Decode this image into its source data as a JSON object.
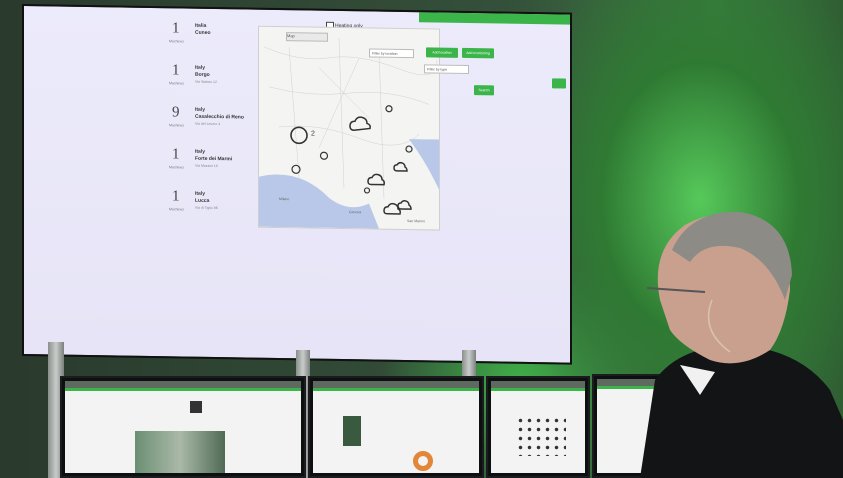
{
  "screen": {
    "top_labels": [
      "Heating only",
      "Filter by location",
      "Filter by type"
    ],
    "buttons": [
      "Add location",
      "Add monitoring",
      "Search"
    ],
    "map_search": "Map"
  },
  "locations": [
    {
      "count": "1",
      "count_label": "Machines",
      "country": "Italia",
      "city": "Cuneo",
      "address": ""
    },
    {
      "count": "1",
      "count_label": "Machines",
      "country": "Italy",
      "city": "Borgo",
      "address": "Via Statuto 12"
    },
    {
      "count": "9",
      "count_label": "Machines",
      "country": "Italy",
      "city": "Casalecchio di Reno",
      "address": "Via del Lavoro 4"
    },
    {
      "count": "1",
      "count_label": "Machines",
      "country": "Italy",
      "city": "Forte dei Marmi",
      "address": "Via Mazzini 18"
    },
    {
      "count": "1",
      "count_label": "Machines",
      "country": "Italy",
      "city": "Lucca",
      "address": "Via di Tiglio 96"
    }
  ],
  "map": {
    "cluster_label": "2",
    "city_labels": [
      "Milano",
      "Genova",
      "San Marino"
    ]
  },
  "colors": {
    "accent": "#3bb54a",
    "screen_bg": "#ecebfb",
    "room_green": "#4fbf55"
  }
}
